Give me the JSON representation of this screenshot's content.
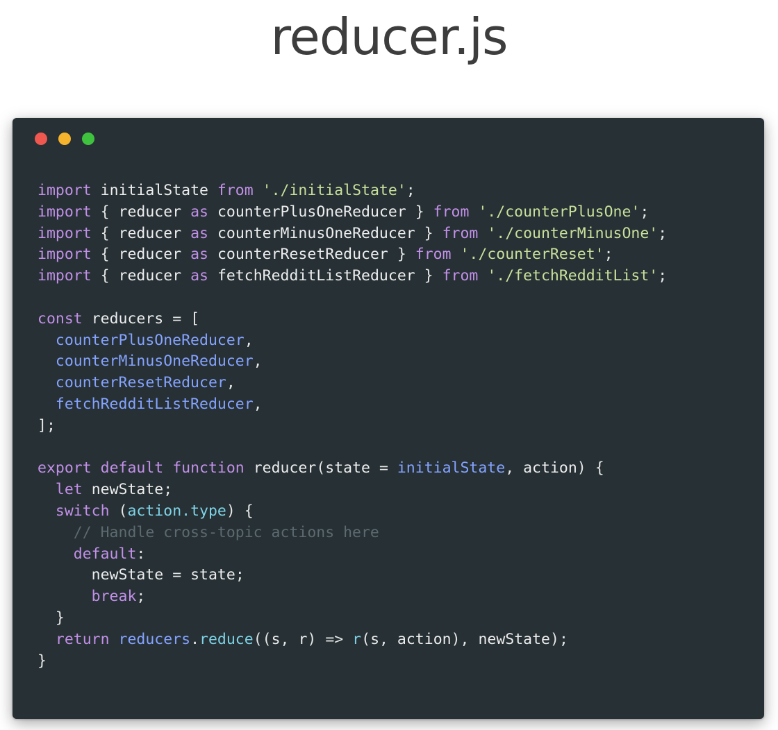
{
  "page": {
    "title": "reducer.js"
  },
  "window": {
    "controls": [
      {
        "name": "close-dot",
        "color": "#f0574f"
      },
      {
        "name": "minimize-dot",
        "color": "#f5b42c"
      },
      {
        "name": "maximize-dot",
        "color": "#3fc33f"
      }
    ]
  },
  "colors": {
    "background": "#263035",
    "keyword": "#c390e8",
    "identifier": "#ededed",
    "string": "#c8e09a",
    "variable": "#85a3ff",
    "property": "#7fd3e6",
    "comment": "#5c6a70"
  },
  "code": {
    "lines": [
      [
        [
          "kw",
          "import"
        ],
        [
          "ws",
          " "
        ],
        [
          "id",
          "initialState"
        ],
        [
          "ws",
          " "
        ],
        [
          "kw",
          "from"
        ],
        [
          "ws",
          " "
        ],
        [
          "str",
          "'./initialState'"
        ],
        [
          "punc",
          ";"
        ]
      ],
      [
        [
          "kw",
          "import"
        ],
        [
          "ws",
          " "
        ],
        [
          "punc",
          "{"
        ],
        [
          "ws",
          " "
        ],
        [
          "id",
          "reducer"
        ],
        [
          "ws",
          " "
        ],
        [
          "kw",
          "as"
        ],
        [
          "ws",
          " "
        ],
        [
          "id",
          "counterPlusOneReducer"
        ],
        [
          "ws",
          " "
        ],
        [
          "punc",
          "}"
        ],
        [
          "ws",
          " "
        ],
        [
          "kw",
          "from"
        ],
        [
          "ws",
          " "
        ],
        [
          "str",
          "'./counterPlusOne'"
        ],
        [
          "punc",
          ";"
        ]
      ],
      [
        [
          "kw",
          "import"
        ],
        [
          "ws",
          " "
        ],
        [
          "punc",
          "{"
        ],
        [
          "ws",
          " "
        ],
        [
          "id",
          "reducer"
        ],
        [
          "ws",
          " "
        ],
        [
          "kw",
          "as"
        ],
        [
          "ws",
          " "
        ],
        [
          "id",
          "counterMinusOneReducer"
        ],
        [
          "ws",
          " "
        ],
        [
          "punc",
          "}"
        ],
        [
          "ws",
          " "
        ],
        [
          "kw",
          "from"
        ],
        [
          "ws",
          " "
        ],
        [
          "str",
          "'./counterMinusOne'"
        ],
        [
          "punc",
          ";"
        ]
      ],
      [
        [
          "kw",
          "import"
        ],
        [
          "ws",
          " "
        ],
        [
          "punc",
          "{"
        ],
        [
          "ws",
          " "
        ],
        [
          "id",
          "reducer"
        ],
        [
          "ws",
          " "
        ],
        [
          "kw",
          "as"
        ],
        [
          "ws",
          " "
        ],
        [
          "id",
          "counterResetReducer"
        ],
        [
          "ws",
          " "
        ],
        [
          "punc",
          "}"
        ],
        [
          "ws",
          " "
        ],
        [
          "kw",
          "from"
        ],
        [
          "ws",
          " "
        ],
        [
          "str",
          "'./counterReset'"
        ],
        [
          "punc",
          ";"
        ]
      ],
      [
        [
          "kw",
          "import"
        ],
        [
          "ws",
          " "
        ],
        [
          "punc",
          "{"
        ],
        [
          "ws",
          " "
        ],
        [
          "id",
          "reducer"
        ],
        [
          "ws",
          " "
        ],
        [
          "kw",
          "as"
        ],
        [
          "ws",
          " "
        ],
        [
          "id",
          "fetchRedditListReducer"
        ],
        [
          "ws",
          " "
        ],
        [
          "punc",
          "}"
        ],
        [
          "ws",
          " "
        ],
        [
          "kw",
          "from"
        ],
        [
          "ws",
          " "
        ],
        [
          "str",
          "'./fetchRedditList'"
        ],
        [
          "punc",
          ";"
        ]
      ],
      [],
      [
        [
          "kw",
          "const"
        ],
        [
          "ws",
          " "
        ],
        [
          "id",
          "reducers"
        ],
        [
          "ws",
          " "
        ],
        [
          "punc",
          "="
        ],
        [
          "ws",
          " "
        ],
        [
          "punc",
          "["
        ]
      ],
      [
        [
          "ws",
          "  "
        ],
        [
          "var",
          "counterPlusOneReducer"
        ],
        [
          "punc",
          ","
        ]
      ],
      [
        [
          "ws",
          "  "
        ],
        [
          "var",
          "counterMinusOneReducer"
        ],
        [
          "punc",
          ","
        ]
      ],
      [
        [
          "ws",
          "  "
        ],
        [
          "var",
          "counterResetReducer"
        ],
        [
          "punc",
          ","
        ]
      ],
      [
        [
          "ws",
          "  "
        ],
        [
          "var",
          "fetchRedditListReducer"
        ],
        [
          "punc",
          ","
        ]
      ],
      [
        [
          "punc",
          "];"
        ]
      ],
      [],
      [
        [
          "kw",
          "export"
        ],
        [
          "ws",
          " "
        ],
        [
          "kw",
          "default"
        ],
        [
          "ws",
          " "
        ],
        [
          "kw",
          "function"
        ],
        [
          "ws",
          " "
        ],
        [
          "id",
          "reducer"
        ],
        [
          "punc",
          "("
        ],
        [
          "id",
          "state"
        ],
        [
          "ws",
          " "
        ],
        [
          "punc",
          "="
        ],
        [
          "ws",
          " "
        ],
        [
          "var",
          "initialState"
        ],
        [
          "punc",
          ","
        ],
        [
          "ws",
          " "
        ],
        [
          "id",
          "action"
        ],
        [
          "punc",
          ")"
        ],
        [
          "ws",
          " "
        ],
        [
          "punc",
          "{"
        ]
      ],
      [
        [
          "ws",
          "  "
        ],
        [
          "kw",
          "let"
        ],
        [
          "ws",
          " "
        ],
        [
          "id",
          "newState"
        ],
        [
          "punc",
          ";"
        ]
      ],
      [
        [
          "ws",
          "  "
        ],
        [
          "kw",
          "switch"
        ],
        [
          "ws",
          " "
        ],
        [
          "punc",
          "("
        ],
        [
          "prop",
          "action.type"
        ],
        [
          "punc",
          ")"
        ],
        [
          "ws",
          " "
        ],
        [
          "punc",
          "{"
        ]
      ],
      [
        [
          "ws",
          "    "
        ],
        [
          "com",
          "// Handle cross-topic actions here"
        ]
      ],
      [
        [
          "ws",
          "    "
        ],
        [
          "kw",
          "default"
        ],
        [
          "punc",
          ":"
        ]
      ],
      [
        [
          "ws",
          "      "
        ],
        [
          "id",
          "newState"
        ],
        [
          "ws",
          " "
        ],
        [
          "punc",
          "="
        ],
        [
          "ws",
          " "
        ],
        [
          "id",
          "state"
        ],
        [
          "punc",
          ";"
        ]
      ],
      [
        [
          "ws",
          "      "
        ],
        [
          "kw",
          "break"
        ],
        [
          "punc",
          ";"
        ]
      ],
      [
        [
          "ws",
          "  "
        ],
        [
          "punc",
          "}"
        ]
      ],
      [
        [
          "ws",
          "  "
        ],
        [
          "kw",
          "return"
        ],
        [
          "ws",
          " "
        ],
        [
          "var",
          "reducers"
        ],
        [
          "punc",
          "."
        ],
        [
          "prop",
          "reduce"
        ],
        [
          "punc",
          "(("
        ],
        [
          "id",
          "s"
        ],
        [
          "punc",
          ","
        ],
        [
          "ws",
          " "
        ],
        [
          "id",
          "r"
        ],
        [
          "punc",
          ")"
        ],
        [
          "ws",
          " "
        ],
        [
          "punc",
          "=>"
        ],
        [
          "ws",
          " "
        ],
        [
          "prop",
          "r"
        ],
        [
          "punc",
          "("
        ],
        [
          "id",
          "s"
        ],
        [
          "punc",
          ","
        ],
        [
          "ws",
          " "
        ],
        [
          "id",
          "action"
        ],
        [
          "punc",
          "),"
        ],
        [
          "ws",
          " "
        ],
        [
          "id",
          "newState"
        ],
        [
          "punc",
          ");"
        ]
      ],
      [
        [
          "punc",
          "}"
        ]
      ]
    ]
  }
}
